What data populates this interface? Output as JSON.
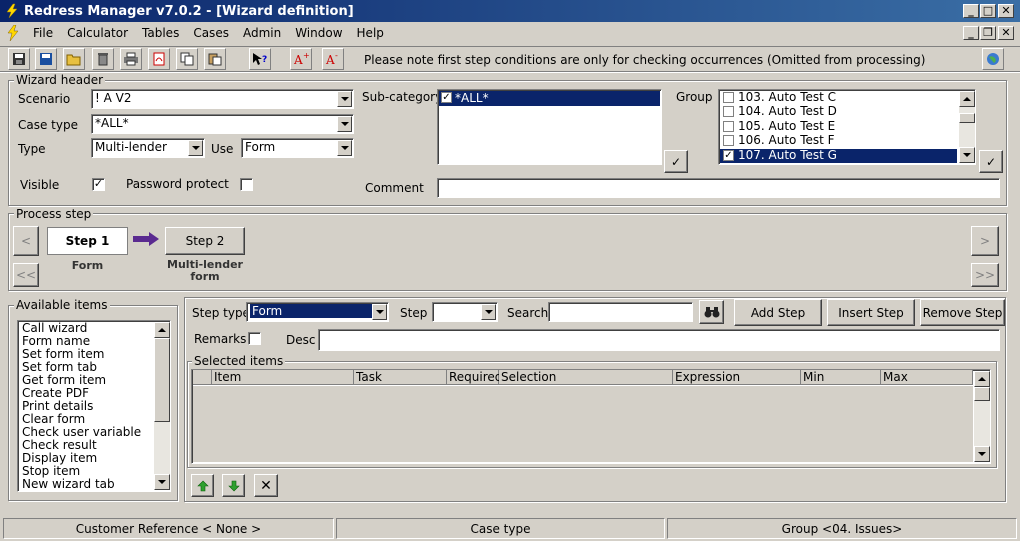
{
  "window": {
    "title": "Redress Manager v7.0.2 - [Wizard definition]"
  },
  "menu": [
    "File",
    "Calculator",
    "Tables",
    "Cases",
    "Admin",
    "Window",
    "Help"
  ],
  "toolbar": {
    "note": "Please note first step conditions are only for checking occurrences (Omitted from processing)"
  },
  "wizard_header": {
    "label": "Wizard header",
    "scenario_label": "Scenario",
    "scenario_value": "! A V2",
    "case_type_label": "Case type",
    "case_type_value": "*ALL*",
    "type_label": "Type",
    "type_value": "Multi-lender",
    "use_label": "Use",
    "use_value": "Form",
    "visible_label": "Visible",
    "visible_checked": true,
    "password_label": "Password protect",
    "password_checked": false,
    "subcategory_label": "Sub-category",
    "subcategory_items": [
      "*ALL*"
    ],
    "group_label": "Group",
    "group_items": [
      {
        "label": "103. Auto Test C",
        "checked": false
      },
      {
        "label": "104. Auto Test D",
        "checked": false
      },
      {
        "label": "105. Auto Test E",
        "checked": false
      },
      {
        "label": "106. Auto Test F",
        "checked": false
      },
      {
        "label": "107. Auto Test G",
        "checked": true
      }
    ],
    "comment_label": "Comment",
    "comment_value": ""
  },
  "process_step": {
    "label": "Process step",
    "nav_prev": "<",
    "nav_first": "<<",
    "nav_next": ">",
    "nav_last": ">>",
    "steps": [
      {
        "name": "Step 1",
        "caption": "Form"
      },
      {
        "name": "Step 2",
        "caption": "Multi-lender\nform"
      }
    ]
  },
  "available_items": {
    "label": "Available items",
    "items": [
      "Call wizard",
      "Form name",
      "Set form item",
      "Set form tab",
      "Get form item",
      "Create PDF",
      "Print details",
      "Clear form",
      "Check user variable",
      "Check result",
      "Display item",
      "Stop item",
      "New wizard tab"
    ]
  },
  "step_editor": {
    "step_type_label": "Step type",
    "step_type_value": "Form",
    "step_label": "Step",
    "step_value": "",
    "search_label": "Search",
    "search_value": "",
    "add_step": "Add Step",
    "insert_step": "Insert Step",
    "remove_step": "Remove Step",
    "remarks_label": "Remarks",
    "desc_label": "Desc",
    "desc_value": "",
    "selected_items_label": "Selected items",
    "columns": [
      "Item",
      "Task",
      "Required",
      "Selection",
      "Expression",
      "Min",
      "Max"
    ]
  },
  "statusbar": {
    "customer_ref": "Customer Reference < None >",
    "case_type": "Case type",
    "group": "Group <04. Issues>"
  },
  "colors": {
    "title_start": "#0a246a",
    "title_end": "#3a6ea5",
    "selection": "#0a246a",
    "face": "#d4d0c8"
  }
}
